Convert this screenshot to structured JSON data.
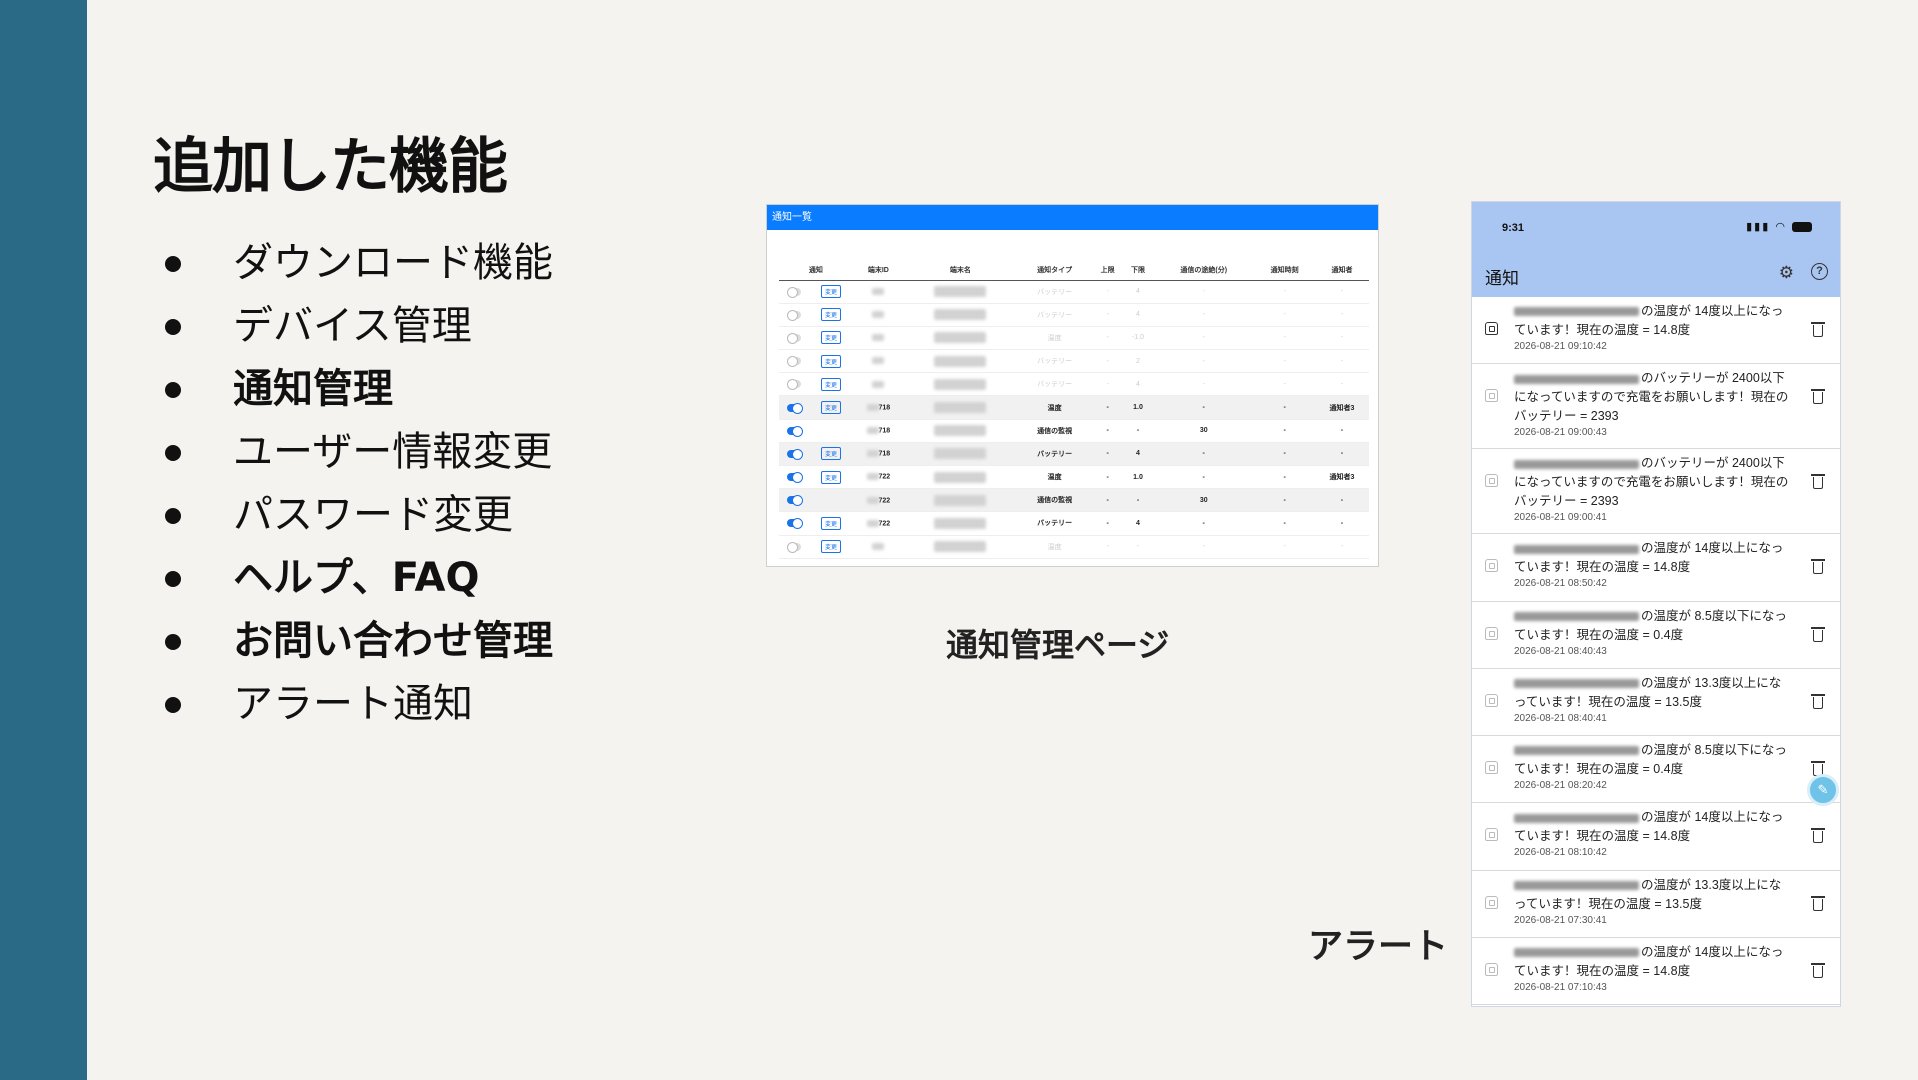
{
  "slide": {
    "title": "追加した機能",
    "features": [
      {
        "label": "ダウンロード機能",
        "bold": false
      },
      {
        "label": "デバイス管理",
        "bold": false
      },
      {
        "label": "通知管理",
        "bold": true
      },
      {
        "label": "ユーザー情報変更",
        "bold": false
      },
      {
        "label": "パスワード変更",
        "bold": false
      },
      {
        "label": "ヘルプ、FAQ",
        "bold": true
      },
      {
        "label": "お問い合わせ管理",
        "bold": true
      },
      {
        "label": "アラート通知",
        "bold": false
      }
    ],
    "caption_table": "通知管理ページ",
    "caption_alert": "アラート"
  },
  "table_screen": {
    "header_title": "通知一覧",
    "columns": [
      "通知",
      "端末ID",
      "端末名",
      "通知タイプ",
      "上限",
      "下限",
      "通信の途絶(分)",
      "通知時刻",
      "通知者"
    ],
    "change_label": "変更",
    "rows": [
      {
        "on": false,
        "change": true,
        "id": "",
        "type": "バッテリー",
        "upper": "-",
        "lower": "4",
        "gap": "-",
        "time": "-",
        "to": "-",
        "dim": true
      },
      {
        "on": false,
        "change": true,
        "id": "",
        "type": "バッテリー",
        "upper": "-",
        "lower": "4",
        "gap": "-",
        "time": "-",
        "to": "-",
        "dim": true
      },
      {
        "on": false,
        "change": true,
        "id": "",
        "type": "温度",
        "upper": "-",
        "lower": "-1.0",
        "gap": "-",
        "time": "-",
        "to": "-",
        "dim": true
      },
      {
        "on": false,
        "change": true,
        "id": "",
        "type": "バッテリー",
        "upper": "-",
        "lower": "2",
        "gap": "-",
        "time": "-",
        "to": "-",
        "dim": true
      },
      {
        "on": false,
        "change": true,
        "id": "",
        "type": "バッテリー",
        "upper": "-",
        "lower": "4",
        "gap": "-",
        "time": "-",
        "to": "-",
        "dim": true
      },
      {
        "on": true,
        "change": true,
        "id": "718",
        "type": "温度",
        "upper": "-",
        "lower": "1.0",
        "gap": "-",
        "time": "-",
        "to": "通知者3",
        "dim": false
      },
      {
        "on": true,
        "change": false,
        "id": "718",
        "type": "通信の監視",
        "upper": "-",
        "lower": "-",
        "gap": "30",
        "time": "-",
        "to": "-",
        "dim": false
      },
      {
        "on": true,
        "change": true,
        "id": "718",
        "type": "バッテリー",
        "upper": "-",
        "lower": "4",
        "gap": "-",
        "time": "-",
        "to": "-",
        "dim": false
      },
      {
        "on": true,
        "change": true,
        "id": "722",
        "type": "温度",
        "upper": "-",
        "lower": "1.0",
        "gap": "-",
        "time": "-",
        "to": "通知者3",
        "dim": false
      },
      {
        "on": true,
        "change": false,
        "id": "722",
        "type": "通信の監視",
        "upper": "-",
        "lower": "-",
        "gap": "30",
        "time": "-",
        "to": "-",
        "dim": false
      },
      {
        "on": true,
        "change": true,
        "id": "722",
        "type": "バッテリー",
        "upper": "-",
        "lower": "4",
        "gap": "-",
        "time": "-",
        "to": "-",
        "dim": false
      },
      {
        "on": false,
        "change": true,
        "id": "",
        "type": "温度",
        "upper": "-",
        "lower": "-",
        "gap": "-",
        "time": "-",
        "to": "-",
        "dim": true
      }
    ]
  },
  "phone": {
    "status_time": "9:31",
    "app_title": "通知",
    "notifications": [
      {
        "text": "の温度が 14度以上になっています！現在の温度 = 14.8度",
        "time": "2026-08-21 09:10:42",
        "unread": true,
        "tall": false
      },
      {
        "text": "のバッテリーが 2400以下になっていますので充電をお願いします！現在のバッテリー = 2393",
        "time": "2026-08-21 09:00:43",
        "unread": false,
        "tall": true
      },
      {
        "text": "のバッテリーが 2400以下になっていますので充電をお願いします！現在のバッテリー = 2393",
        "time": "2026-08-21 09:00:41",
        "unread": false,
        "tall": true
      },
      {
        "text": "の温度が 14度以上になっています！現在の温度 = 14.8度",
        "time": "2026-08-21 08:50:42",
        "unread": false,
        "tall": false
      },
      {
        "text": "の温度が 8.5度以下になっています！現在の温度 = 0.4度",
        "time": "2026-08-21 08:40:43",
        "unread": false,
        "tall": false
      },
      {
        "text": "の温度が 13.3度以上になっています！現在の温度 = 13.5度",
        "time": "2026-08-21 08:40:41",
        "unread": false,
        "tall": false
      },
      {
        "text": "の温度が 8.5度以下になっています！現在の温度 = 0.4度",
        "time": "2026-08-21 08:20:42",
        "unread": false,
        "tall": false
      },
      {
        "text": "の温度が 14度以上になっています！現在の温度 = 14.8度",
        "time": "2026-08-21 08:10:42",
        "unread": false,
        "tall": false
      },
      {
        "text": "の温度が 13.3度以上になっています！現在の温度 = 13.5度",
        "time": "2026-08-21 07:30:41",
        "unread": false,
        "tall": false
      },
      {
        "text": "の温度が 14度以上になっています！現在の温度 = 14.8度",
        "time": "2026-08-21 07:10:43",
        "unread": false,
        "tall": false
      }
    ]
  }
}
